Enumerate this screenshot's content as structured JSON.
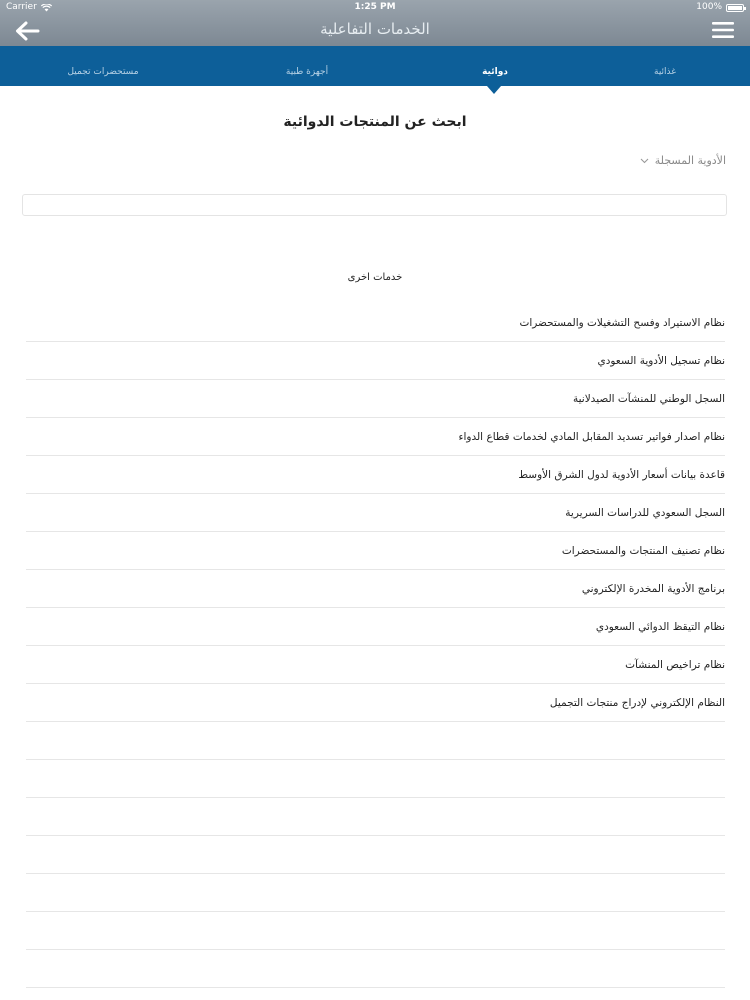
{
  "status_bar": {
    "carrier": "Carrier",
    "time": "1:25 PM",
    "battery": "100%"
  },
  "nav": {
    "title": "الخدمات التفاعلية"
  },
  "tabs": [
    {
      "label": "غذائية",
      "active": false
    },
    {
      "label": "دوائية",
      "active": true
    },
    {
      "label": "أجهزة طبية",
      "active": false
    },
    {
      "label": "مستحضرات تجميل",
      "active": false
    }
  ],
  "search": {
    "title": "ابحث عن المنتجات الدوائية",
    "dropdown_value": "الأدوية المسجلة",
    "placeholder": ""
  },
  "other_services": {
    "title": "خدمات اخرى",
    "items": [
      "نظام الاستيراد وفسح التشغيلات والمستحضرات",
      "نظام تسجيل الأدوية السعودي",
      "السجل الوطني للمنشآت الصيدلانية",
      "نظام اصدار فواتير تسديد المقابل المادي لخدمات قطاع الدواء",
      "قاعدة بيانات أسعار الأدوية لدول الشرق الأوسط",
      "السجل السعودي للدراسات السريرية",
      "نظام تصنيف المنتجات والمستحضرات",
      "برنامج الأدوية المخدرة الإلكتروني",
      "نظام التيقظ الدوائي السعودي",
      "نظام تراخيص المنشآت",
      "النظام الإلكتروني لإدراج منتجات التجميل"
    ]
  },
  "colors": {
    "header": "#8a949e",
    "tabbar": "#0d5f99",
    "divider": "#e6e6e6"
  }
}
